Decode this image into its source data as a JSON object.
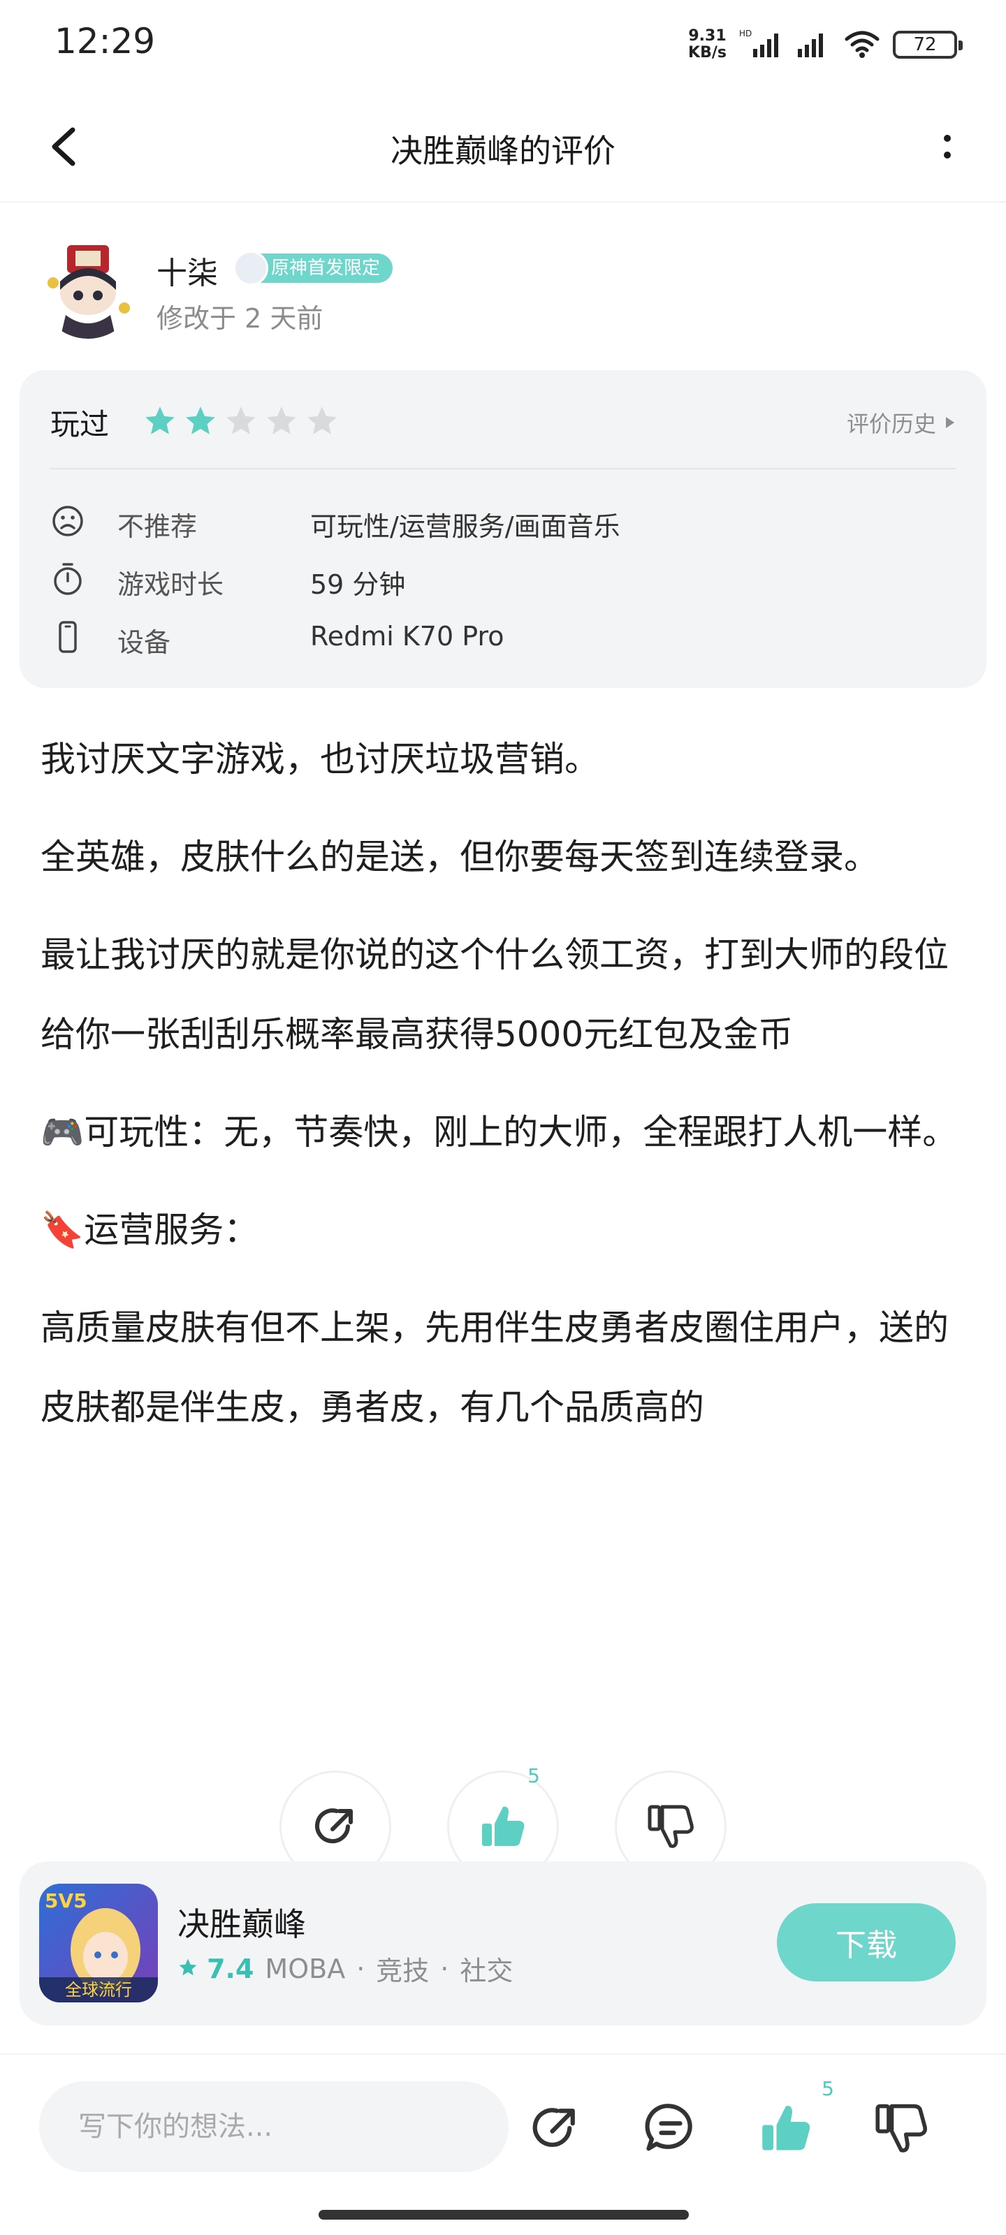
{
  "status_bar": {
    "time": "12:29",
    "net_speed_value": "9.31",
    "net_speed_unit": "KB/s",
    "hd_label": "HD",
    "battery": "72"
  },
  "header": {
    "title": "决胜巅峰的评价",
    "back_icon": "chevron-left-icon",
    "more_icon": "more-vertical-icon"
  },
  "author": {
    "name": "十柒",
    "tag": "原神首发限定",
    "edit_time": "修改于 2 天前"
  },
  "rating": {
    "status": "玩过",
    "stars": 2,
    "max_stars": 5,
    "history_label": "评价历史",
    "star_color": "#5ecfc3",
    "star_empty_color": "#d9dadc"
  },
  "details": [
    {
      "icon": "sad-face-icon",
      "label": "不推荐",
      "value": "可玩性/运营服务/画面音乐"
    },
    {
      "icon": "stopwatch-icon",
      "label": "游戏时长",
      "value": "59 分钟"
    },
    {
      "icon": "phone-icon",
      "label": "设备",
      "value": "Redmi  K70 Pro"
    }
  ],
  "review": {
    "paragraphs": [
      "我讨厌文字游戏，也讨厌垃圾营销。",
      "全英雄，皮肤什么的是送，但你要每天签到连续登录。",
      "最让我讨厌的就是你说的这个什么领工资，打到大师的段位给你一张刮刮乐概率最高获得5000元红包及金币",
      "🎮可玩性：无，节奏快，刚上的大师，全程跟打人机一样。",
      "🔖运营服务：",
      "高质量皮肤有但不上架，先用伴生皮勇者皮圈住用户，送的皮肤都是伴生皮，勇者皮，有几个品质高的"
    ]
  },
  "floating_actions": {
    "share_icon": "share-icon",
    "like_icon": "thumbs-up-icon",
    "like_count": "5",
    "dislike_icon": "thumbs-down-icon"
  },
  "game": {
    "name": "决胜巅峰",
    "score": "7.4",
    "tags": [
      "MOBA",
      "竞技",
      "社交"
    ],
    "separator": "·",
    "download_label": "下载",
    "icon_badge": "5V5",
    "icon_banner": "全球流行"
  },
  "bottom_bar": {
    "comment_placeholder": "写下你的想法...",
    "like_count": "5",
    "accent_color": "#4fc9bd"
  }
}
